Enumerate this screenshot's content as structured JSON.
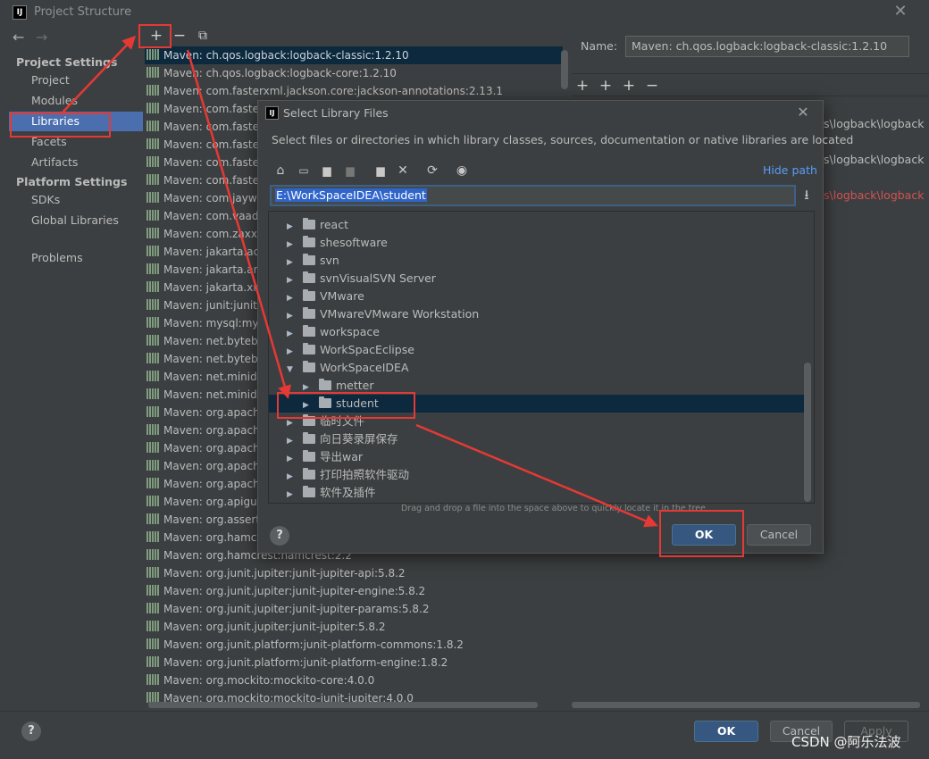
{
  "window": {
    "logo": "IJ",
    "title": "Project Structure",
    "close": "✕"
  },
  "sidebar": {
    "back": "←",
    "forward": "→",
    "project_settings_heading": "Project Settings",
    "project_items": [
      "Project",
      "Modules",
      "Libraries",
      "Facets",
      "Artifacts"
    ],
    "platform_settings_heading": "Platform Settings",
    "platform_items": [
      "SDKs",
      "Global Libraries"
    ],
    "problems": "Problems",
    "selected": "Libraries"
  },
  "list_toolbar": {
    "add": "+",
    "remove": "−",
    "copy": "⧉"
  },
  "libraries": [
    "Maven: ch.qos.logback:logback-classic:1.2.10",
    "Maven: ch.qos.logback:logback-core:1.2.10",
    "Maven: com.fasterxml.jackson.core:jackson-annotations:2.13.1",
    "Maven: com.faste",
    "Maven: com.faste",
    "Maven: com.faste",
    "Maven: com.faste",
    "Maven: com.faste",
    "Maven: com.jayw",
    "Maven: com.vaadi",
    "Maven: com.zaxxe",
    "Maven: jakarta.act",
    "Maven: jakarta.an",
    "Maven: jakarta.xr",
    "Maven: junit:junit:",
    "Maven: mysql:mys",
    "Maven: net.bytebu",
    "Maven: net.bytebu",
    "Maven: net.minide",
    "Maven: net.minide",
    "Maven: org.apach",
    "Maven: org.apach",
    "Maven: org.apach",
    "Maven: org.apach",
    "Maven: org.apach",
    "Maven: org.apigu",
    "Maven: org.assert",
    "Maven: org.hamcr",
    "Maven: org.hamcrest:hamcrest:2.2",
    "Maven: org.junit.jupiter:junit-jupiter-api:5.8.2",
    "Maven: org.junit.jupiter:junit-jupiter-engine:5.8.2",
    "Maven: org.junit.jupiter:junit-jupiter-params:5.8.2",
    "Maven: org.junit.jupiter:junit-jupiter:5.8.2",
    "Maven: org.junit.platform:junit-platform-commons:1.8.2",
    "Maven: org.junit.platform:junit-platform-engine:1.8.2",
    "Maven: org.mockito:mockito-core:4.0.0",
    "Maven: org.mockito:mockito-junit-jupiter:4.0.0"
  ],
  "details": {
    "name_label": "Name:",
    "name_value": "Maven: ch.qos.logback:logback-classic:1.2.10",
    "toolbar": [
      "+",
      "+",
      "+",
      "−"
    ],
    "path_fragments": [
      "s\\logback\\logback",
      "s\\logback\\logback",
      "s\\logback\\logback"
    ]
  },
  "dialog": {
    "logo": "IJ",
    "title": "Select Library Files",
    "close": "✕",
    "description": "Select files or directories in which library classes, sources, documentation or native libraries are located",
    "hide_path": "Hide path",
    "path": "E:\\WorkSpaceIDEA\\student",
    "tree": [
      {
        "label": "react",
        "expanded": false,
        "depth": 0
      },
      {
        "label": "shesoftware",
        "expanded": false,
        "depth": 0
      },
      {
        "label": "svn",
        "expanded": false,
        "depth": 0
      },
      {
        "label": "svnVisualSVN Server",
        "expanded": false,
        "depth": 0
      },
      {
        "label": "VMware",
        "expanded": false,
        "depth": 0
      },
      {
        "label": "VMwareVMware Workstation",
        "expanded": false,
        "depth": 0
      },
      {
        "label": "workspace",
        "expanded": false,
        "depth": 0
      },
      {
        "label": "WorkSpacEclipse",
        "expanded": false,
        "depth": 0
      },
      {
        "label": "WorkSpaceIDEA",
        "expanded": true,
        "depth": 0
      },
      {
        "label": "metter",
        "expanded": false,
        "depth": 1
      },
      {
        "label": "student",
        "expanded": false,
        "depth": 1,
        "selected": true
      },
      {
        "label": "临时文件",
        "expanded": false,
        "depth": 0
      },
      {
        "label": "向日葵录屏保存",
        "expanded": false,
        "depth": 0
      },
      {
        "label": "导出war",
        "expanded": false,
        "depth": 0
      },
      {
        "label": "打印拍照软件驱动",
        "expanded": false,
        "depth": 0
      },
      {
        "label": "软件及插件",
        "expanded": false,
        "depth": 0
      }
    ],
    "dnd_hint": "Drag and drop a file into the space above to quickly locate it in the tree",
    "help": "?",
    "ok": "OK",
    "cancel": "Cancel"
  },
  "bottom": {
    "help": "?",
    "ok": "OK",
    "cancel": "Cancel",
    "apply": "Apply"
  },
  "watermark": "CSDN @阿乐法波",
  "colors": {
    "background": "#3c3f41",
    "selection": "#4b6eaf",
    "annotation_red": "#e53935",
    "link": "#589df6",
    "error_text": "#d25252"
  }
}
